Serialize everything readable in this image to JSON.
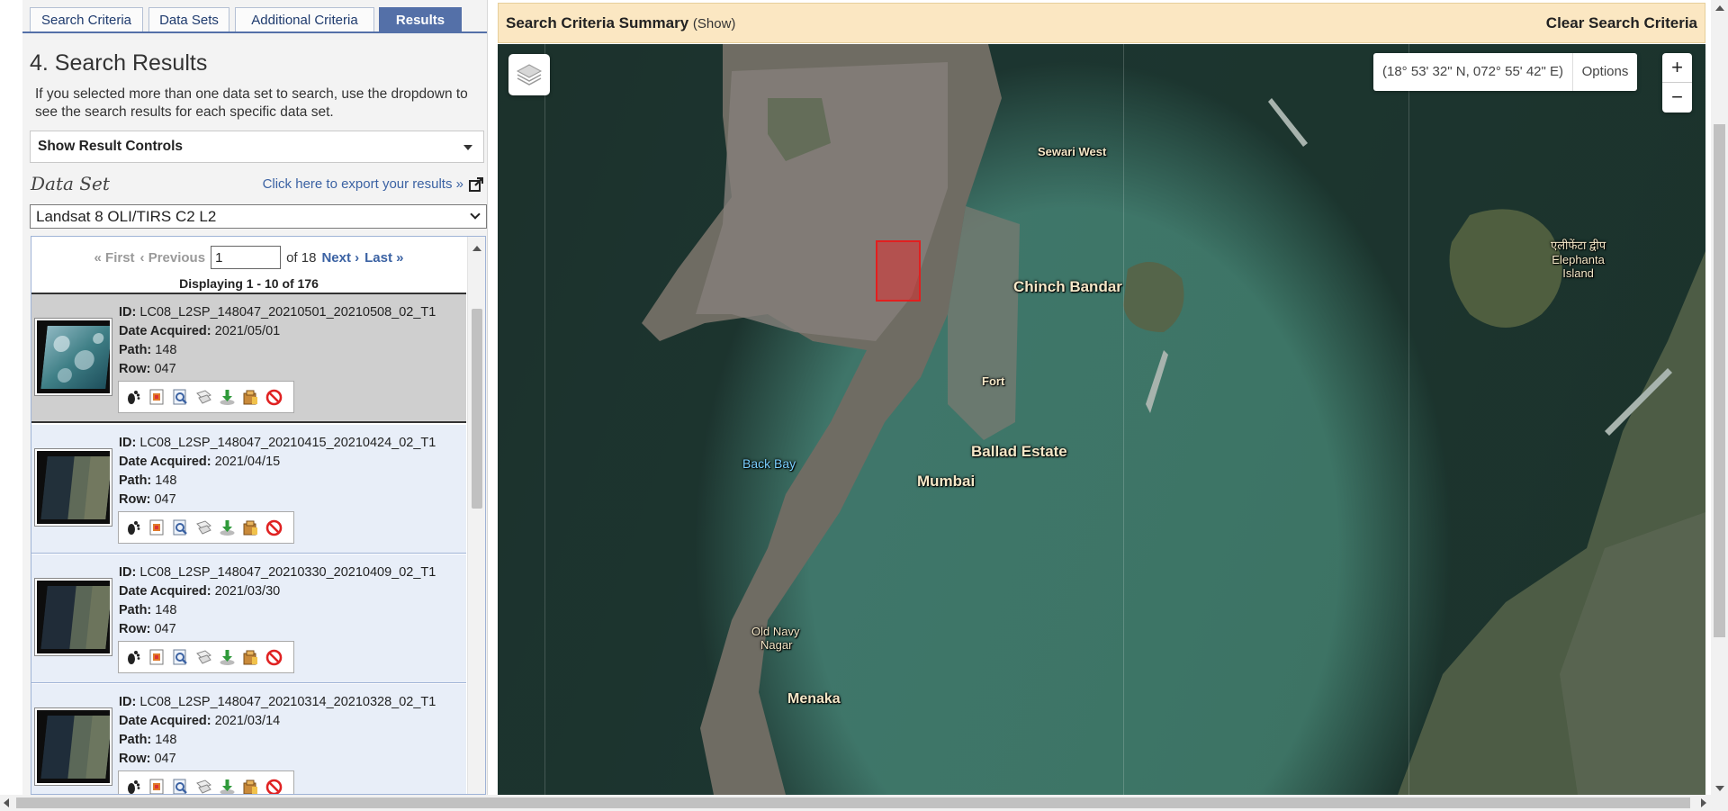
{
  "tabs": [
    {
      "label": "Search Criteria",
      "active": false
    },
    {
      "label": "Data Sets",
      "active": false
    },
    {
      "label": "Additional Criteria",
      "active": false
    },
    {
      "label": "Results",
      "active": true
    }
  ],
  "results": {
    "title": "4. Search Results",
    "intro": "If you selected more than one data set to search, use the dropdown to see the search results for each specific data set.",
    "controls_label": "Show Result Controls",
    "dataset_label": "Data Set",
    "export_label": "Click here to export your results »",
    "dataset_selected": "Landsat 8 OLI/TIRS C2 L2",
    "pager": {
      "first": "« First",
      "previous": "‹ Previous",
      "page": "1",
      "of_total": "of 18",
      "next": "Next ›",
      "last": "Last »",
      "displaying": "Displaying 1 - 10 of 176"
    },
    "field_labels": {
      "id": "ID:",
      "date": "Date Acquired:",
      "path": "Path:",
      "row": "Row:"
    },
    "items": [
      {
        "id": "LC08_L2SP_148047_20210501_20210508_02_T1",
        "date": "2021/05/01",
        "path": "148",
        "row": "047",
        "selected": true
      },
      {
        "id": "LC08_L2SP_148047_20210415_20210424_02_T1",
        "date": "2021/04/15",
        "path": "148",
        "row": "047",
        "selected": false
      },
      {
        "id": "LC08_L2SP_148047_20210330_20210409_02_T1",
        "date": "2021/03/30",
        "path": "148",
        "row": "047",
        "selected": false
      },
      {
        "id": "LC08_L2SP_148047_20210314_20210328_02_T1",
        "date": "2021/03/14",
        "path": "148",
        "row": "047",
        "selected": false
      }
    ],
    "tool_icons": [
      "footprint-icon",
      "browse-overlay-icon",
      "metadata-icon",
      "compare-icon",
      "download-icon",
      "order-icon",
      "exclude-icon"
    ]
  },
  "summary": {
    "title": "Search Criteria Summary",
    "show": "(Show)",
    "clear": "Clear Search Criteria"
  },
  "map": {
    "coords": "(18° 53' 32\" N, 072° 55' 42\" E)",
    "options": "Options",
    "zoom_in": "+",
    "zoom_out": "−",
    "labels": {
      "sewari_west": "Sewari West",
      "chinch_bandar": "Chinch Bandar",
      "fort": "Fort",
      "ballad_estate": "Ballad Estate",
      "mumbai": "Mumbai",
      "back_bay": "Back Bay",
      "old_navy_nagar_1": "Old Navy",
      "old_navy_nagar_2": "Nagar",
      "menaka": "Menaka",
      "elephanta_1": "एलीफेंटा द्वीप",
      "elephanta_2": "Elephanta",
      "elephanta_3": "Island"
    }
  }
}
